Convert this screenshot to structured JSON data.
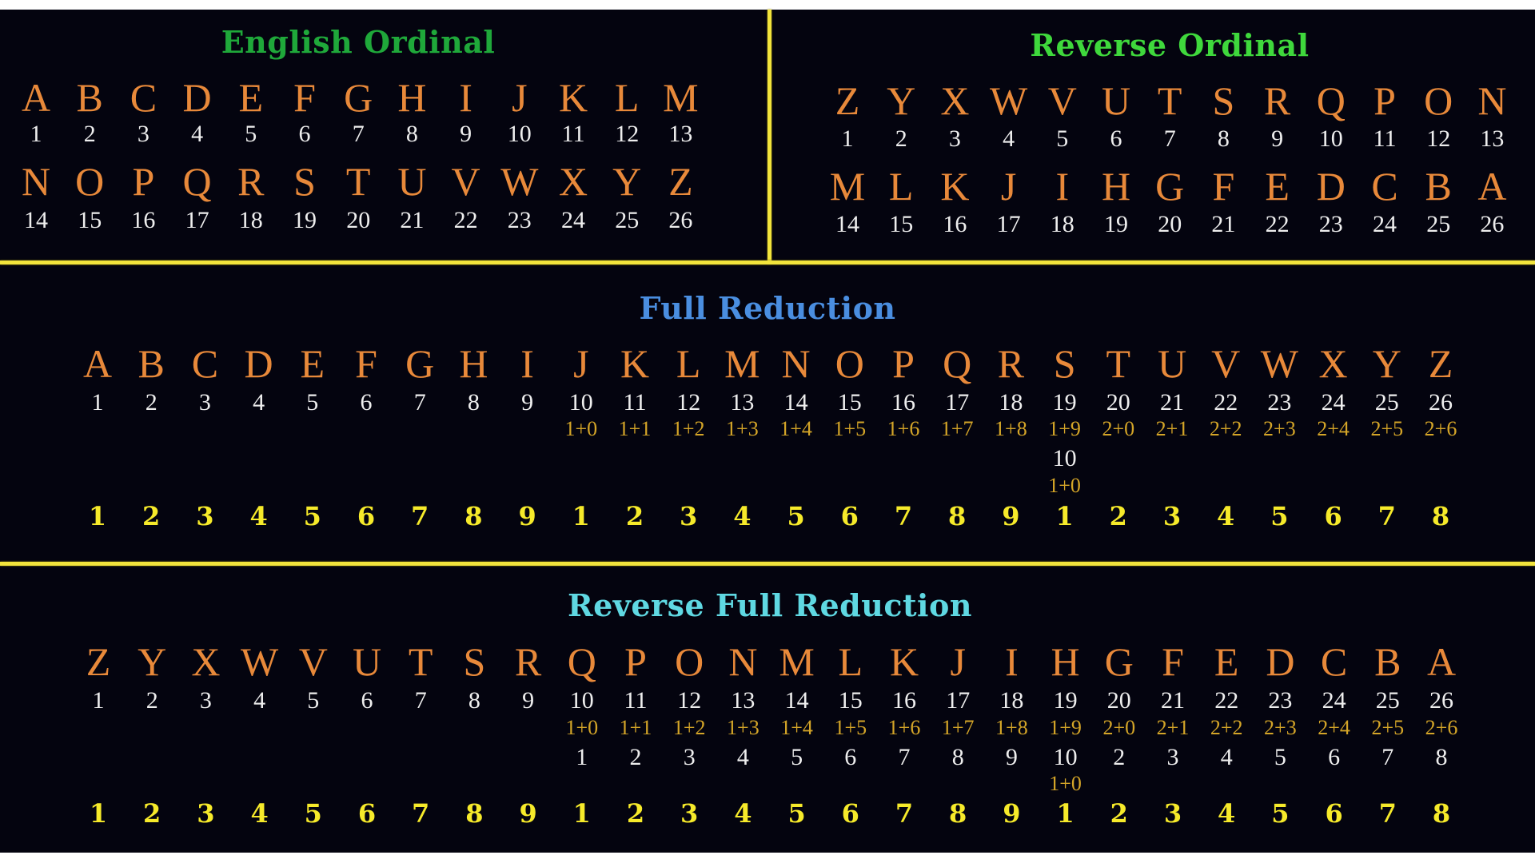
{
  "colors": {
    "background": "#04040f",
    "divider": "#f2e43c",
    "letter": "#e8893a",
    "number": "#eeeeee",
    "digit_sum": "#d4a528",
    "reduced": "#f6ea2a"
  },
  "english_ordinal": {
    "title": "English Ordinal",
    "title_color": "#1fa83a",
    "rows": [
      {
        "letters": [
          "A",
          "B",
          "C",
          "D",
          "E",
          "F",
          "G",
          "H",
          "I",
          "J",
          "K",
          "L",
          "M"
        ],
        "values": [
          "1",
          "2",
          "3",
          "4",
          "5",
          "6",
          "7",
          "8",
          "9",
          "10",
          "11",
          "12",
          "13"
        ]
      },
      {
        "letters": [
          "N",
          "O",
          "P",
          "Q",
          "R",
          "S",
          "T",
          "U",
          "V",
          "W",
          "X",
          "Y",
          "Z"
        ],
        "values": [
          "14",
          "15",
          "16",
          "17",
          "18",
          "19",
          "20",
          "21",
          "22",
          "23",
          "24",
          "25",
          "26"
        ]
      }
    ]
  },
  "reverse_ordinal": {
    "title": "Reverse Ordinal",
    "title_color": "#3fd83c",
    "rows": [
      {
        "letters": [
          "Z",
          "Y",
          "X",
          "W",
          "V",
          "U",
          "T",
          "S",
          "R",
          "Q",
          "P",
          "O",
          "N"
        ],
        "values": [
          "1",
          "2",
          "3",
          "4",
          "5",
          "6",
          "7",
          "8",
          "9",
          "10",
          "11",
          "12",
          "13"
        ]
      },
      {
        "letters": [
          "M",
          "L",
          "K",
          "J",
          "I",
          "H",
          "G",
          "F",
          "E",
          "D",
          "C",
          "B",
          "A"
        ],
        "values": [
          "14",
          "15",
          "16",
          "17",
          "18",
          "19",
          "20",
          "21",
          "22",
          "23",
          "24",
          "25",
          "26"
        ]
      }
    ]
  },
  "full_reduction": {
    "title": "Full Reduction",
    "title_color": "#4a8ee0",
    "letters": [
      "A",
      "B",
      "C",
      "D",
      "E",
      "F",
      "G",
      "H",
      "I",
      "J",
      "K",
      "L",
      "M",
      "N",
      "O",
      "P",
      "Q",
      "R",
      "S",
      "T",
      "U",
      "V",
      "W",
      "X",
      "Y",
      "Z"
    ],
    "values": [
      "1",
      "2",
      "3",
      "4",
      "5",
      "6",
      "7",
      "8",
      "9",
      "10",
      "11",
      "12",
      "13",
      "14",
      "15",
      "16",
      "17",
      "18",
      "19",
      "20",
      "21",
      "22",
      "23",
      "24",
      "25",
      "26"
    ],
    "digit_sums": [
      "",
      "",
      "",
      "",
      "",
      "",
      "",
      "",
      "",
      "1+0",
      "1+1",
      "1+2",
      "1+3",
      "1+4",
      "1+5",
      "1+6",
      "1+7",
      "1+8",
      "1+9",
      "2+0",
      "2+1",
      "2+2",
      "2+3",
      "2+4",
      "2+5",
      "2+6"
    ],
    "intermediate": [
      "",
      "",
      "",
      "",
      "",
      "",
      "",
      "",
      "",
      "",
      "",
      "",
      "",
      "",
      "",
      "",
      "",
      "",
      "10",
      "",
      "",
      "",
      "",
      "",
      "",
      ""
    ],
    "intermediate_sums": [
      "",
      "",
      "",
      "",
      "",
      "",
      "",
      "",
      "",
      "",
      "",
      "",
      "",
      "",
      "",
      "",
      "",
      "",
      "1+0",
      "",
      "",
      "",
      "",
      "",
      "",
      ""
    ],
    "reduced": [
      "1",
      "2",
      "3",
      "4",
      "5",
      "6",
      "7",
      "8",
      "9",
      "1",
      "2",
      "3",
      "4",
      "5",
      "6",
      "7",
      "8",
      "9",
      "1",
      "2",
      "3",
      "4",
      "5",
      "6",
      "7",
      "8"
    ]
  },
  "reverse_full_reduction": {
    "title": "Reverse Full Reduction",
    "title_color": "#5fd8e2",
    "letters": [
      "Z",
      "Y",
      "X",
      "W",
      "V",
      "U",
      "T",
      "S",
      "R",
      "Q",
      "P",
      "O",
      "N",
      "M",
      "L",
      "K",
      "J",
      "I",
      "H",
      "G",
      "F",
      "E",
      "D",
      "C",
      "B",
      "A"
    ],
    "values": [
      "1",
      "2",
      "3",
      "4",
      "5",
      "6",
      "7",
      "8",
      "9",
      "10",
      "11",
      "12",
      "13",
      "14",
      "15",
      "16",
      "17",
      "18",
      "19",
      "20",
      "21",
      "22",
      "23",
      "24",
      "25",
      "26"
    ],
    "digit_sums": [
      "",
      "",
      "",
      "",
      "",
      "",
      "",
      "",
      "",
      "1+0",
      "1+1",
      "1+2",
      "1+3",
      "1+4",
      "1+5",
      "1+6",
      "1+7",
      "1+8",
      "1+9",
      "2+0",
      "2+1",
      "2+2",
      "2+3",
      "2+4",
      "2+5",
      "2+6"
    ],
    "intermediate": [
      "",
      "",
      "",
      "",
      "",
      "",
      "",
      "",
      "",
      "1",
      "2",
      "3",
      "4",
      "5",
      "6",
      "7",
      "8",
      "9",
      "10",
      "2",
      "3",
      "4",
      "5",
      "6",
      "7",
      "8"
    ],
    "intermediate_sums": [
      "",
      "",
      "",
      "",
      "",
      "",
      "",
      "",
      "",
      "",
      "",
      "",
      "",
      "",
      "",
      "",
      "",
      "",
      "1+0",
      "",
      "",
      "",
      "",
      "",
      "",
      ""
    ],
    "reduced": [
      "1",
      "2",
      "3",
      "4",
      "5",
      "6",
      "7",
      "8",
      "9",
      "1",
      "2",
      "3",
      "4",
      "5",
      "6",
      "7",
      "8",
      "9",
      "1",
      "2",
      "3",
      "4",
      "5",
      "6",
      "7",
      "8"
    ]
  }
}
